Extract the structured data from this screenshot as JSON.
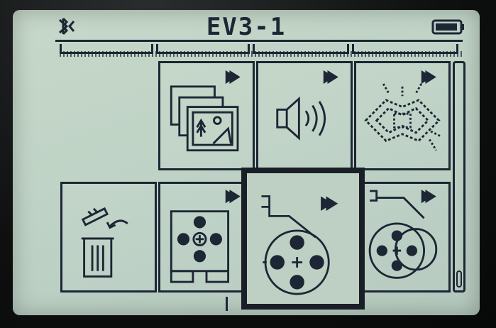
{
  "window": {
    "title": "EV3-1"
  },
  "statusbar": {
    "bluetooth_icon": "bluetooth-icon",
    "battery_icon": "battery-icon"
  },
  "tabs": [
    {
      "name": "tab-1"
    },
    {
      "name": "tab-2"
    },
    {
      "name": "tab-3"
    },
    {
      "name": "tab-4"
    }
  ],
  "tiles": [
    {
      "name": "image-browser-app",
      "icon": "images-icon",
      "has_run_arrow": true
    },
    {
      "name": "sound-browser-app",
      "icon": "speaker-icon",
      "has_run_arrow": true
    },
    {
      "name": "brick-program-app",
      "icon": "light-pattern-icon",
      "has_run_arrow": true
    },
    {
      "name": "delete-files-app",
      "icon": "trash-icon",
      "has_run_arrow": false
    },
    {
      "name": "motor-control-app",
      "icon": "brick-buttons-icon",
      "has_run_arrow": true
    },
    {
      "name": "ir-control-app",
      "icon": "motor-wheel-icon",
      "has_run_arrow": true,
      "selected": true
    },
    {
      "name": "port-view-app",
      "icon": "motor-wheels-icon",
      "has_run_arrow": true
    }
  ],
  "colors": {
    "lcd_background": "#c2d5c7",
    "lcd_ink": "#1d2634",
    "bezel": "#0d0f0f"
  }
}
